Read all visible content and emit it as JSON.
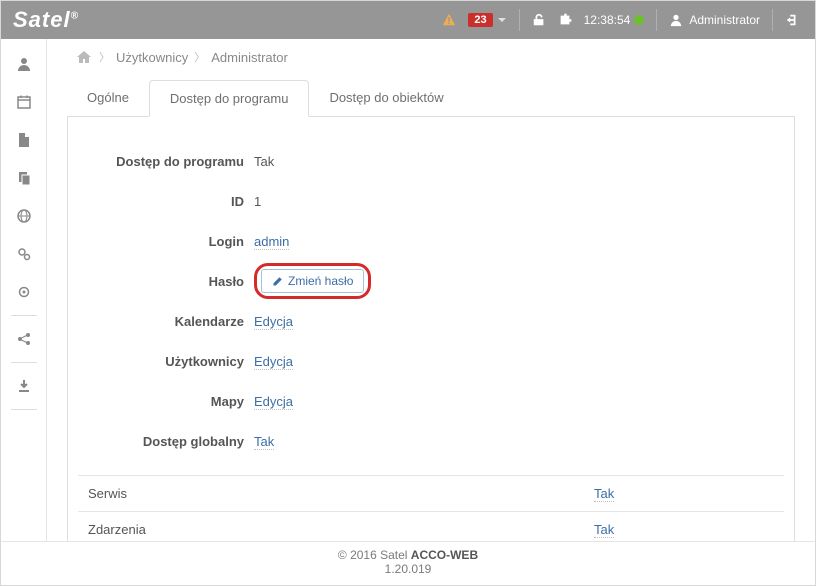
{
  "header": {
    "brand": "Satel",
    "brand_suffix": "®",
    "alerts_badge": "23",
    "time": "12:38:54",
    "user_label": "Administrator"
  },
  "breadcrumb": {
    "home_icon": "home",
    "items": [
      "Użytkownicy",
      "Administrator"
    ]
  },
  "tabs": [
    {
      "label": "Ogólne",
      "active": false
    },
    {
      "label": "Dostęp do programu",
      "active": true
    },
    {
      "label": "Dostęp do obiektów",
      "active": false
    }
  ],
  "form": {
    "access_label": "Dostęp do programu",
    "access_value": "Tak",
    "id_label": "ID",
    "id_value": "1",
    "login_label": "Login",
    "login_value": "admin",
    "password_label": "Hasło",
    "password_button": "Zmień hasło",
    "calendars_label": "Kalendarze",
    "calendars_value": "Edycja",
    "users_label": "Użytkownicy",
    "users_value": "Edycja",
    "maps_label": "Mapy",
    "maps_value": "Edycja",
    "global_label": "Dostęp globalny",
    "global_value": "Tak"
  },
  "bottom_table": [
    {
      "label": "Serwis",
      "value": "Tak"
    },
    {
      "label": "Zdarzenia",
      "value": "Tak"
    }
  ],
  "footer": {
    "copyright_prefix": "© 2016 Satel ",
    "copyright_bold": "ACCO-WEB",
    "version": "1.20.019"
  },
  "sidebar": {
    "items": [
      {
        "name": "user-icon"
      },
      {
        "name": "calendar-icon"
      },
      {
        "name": "file-icon"
      },
      {
        "name": "copy-icon"
      },
      {
        "name": "globe-icon"
      },
      {
        "name": "gears-icon"
      },
      {
        "name": "gear-icon"
      }
    ],
    "items2": [
      {
        "name": "share-icon"
      }
    ],
    "items3": [
      {
        "name": "download-icon"
      }
    ]
  }
}
